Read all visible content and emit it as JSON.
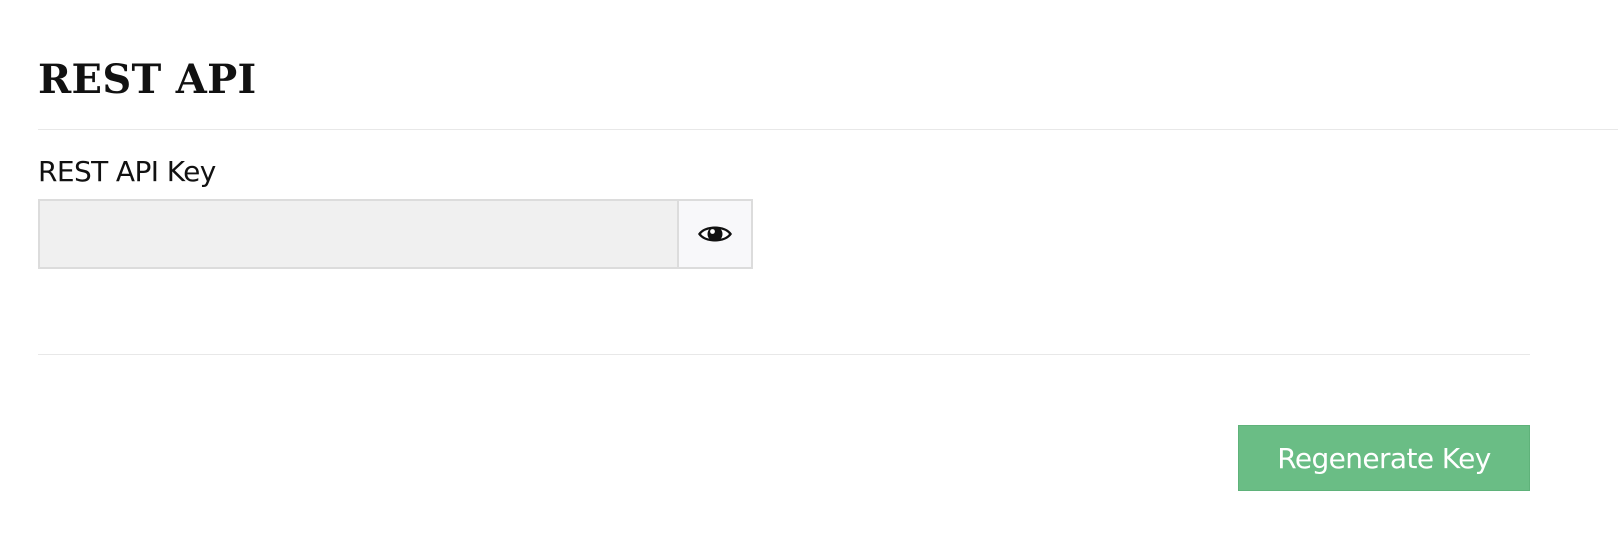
{
  "page": {
    "title": "REST API"
  },
  "api_key_field": {
    "label": "REST API Key",
    "value": "",
    "placeholder": "",
    "reveal_icon": "eye-icon"
  },
  "actions": {
    "regenerate_label": "Regenerate Key"
  },
  "colors": {
    "accent": "#6abd85",
    "input_background": "#f0f0f0",
    "divider": "#e8e8e8"
  }
}
